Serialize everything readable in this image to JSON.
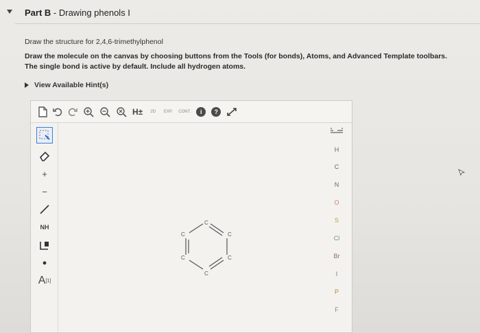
{
  "part": {
    "prefix": "Part B",
    "separator": " - ",
    "title": "Drawing phenols I"
  },
  "question": {
    "text": "Draw the structure for 2,4,6-trimethylphenol"
  },
  "instructions": "Draw the molecule on the canvas by choosing buttons from the Tools (for bonds), Atoms, and Advanced Template toolbars. The single bond is active by default. Include all hydrogen atoms.",
  "hint": {
    "label": "View Available Hint(s)"
  },
  "toolbar": {
    "h_label": "H±",
    "twod_label": "2D",
    "exp_label": "EXP.",
    "cont_label": "CONT.",
    "info_label": "i",
    "help_label": "?"
  },
  "left_tools": {
    "plus": "+",
    "minus": "−",
    "chain": "NH",
    "charge_label": "A",
    "charge_sup": "[1]"
  },
  "atoms": {
    "periodic_table_label": "periodic table",
    "items": [
      "H",
      "C",
      "N",
      "O",
      "S",
      "Cl",
      "Br",
      "I",
      "P",
      "F"
    ]
  },
  "molecule": {
    "atom_labels": [
      "C",
      "C",
      "C",
      "C",
      "C",
      "C"
    ]
  }
}
